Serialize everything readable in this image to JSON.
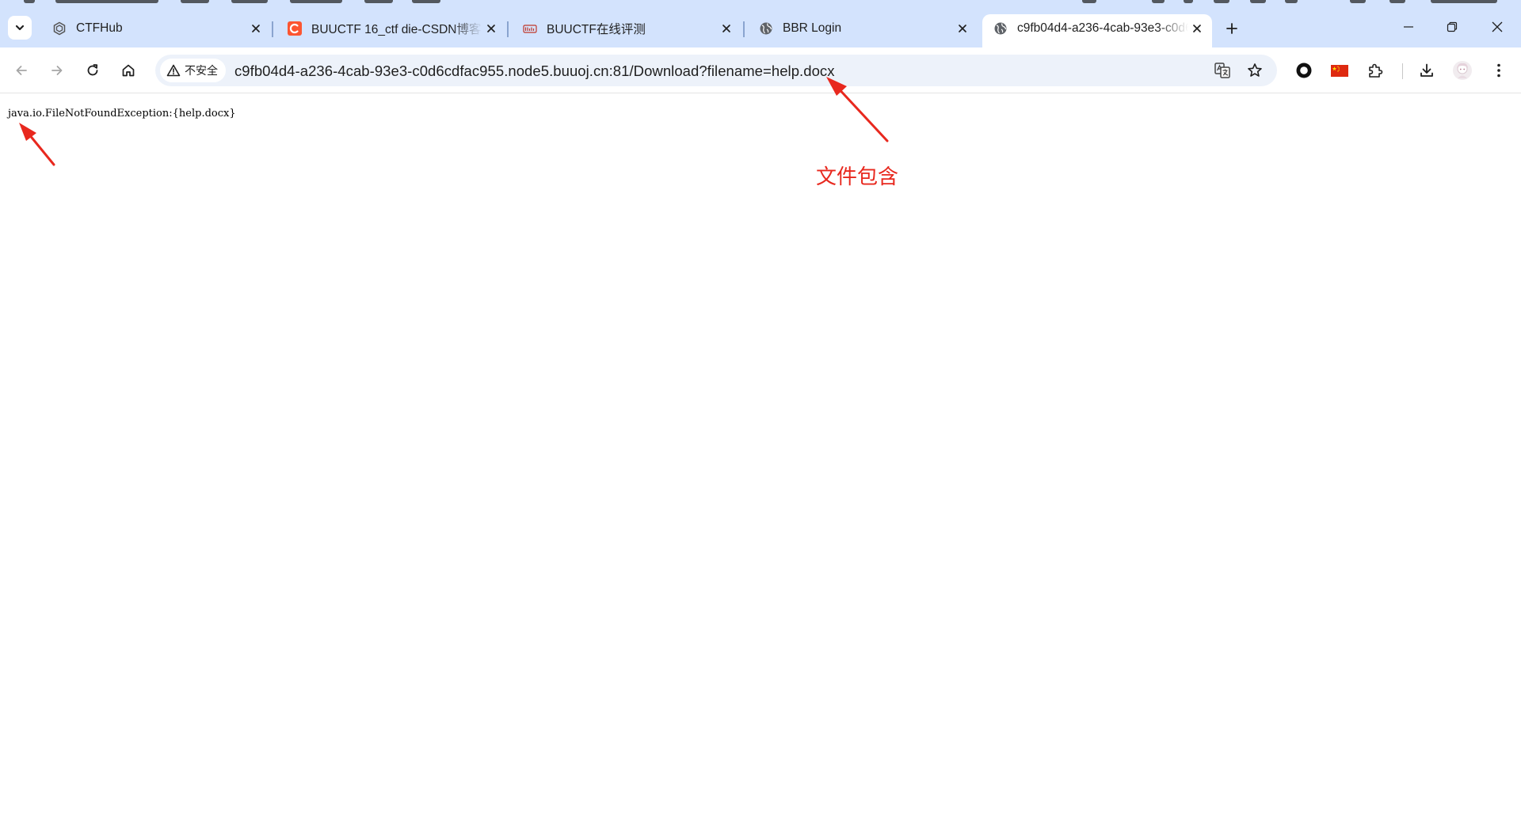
{
  "browser": {
    "tab_list_icon": "chevron-down-icon",
    "tabs": [
      {
        "title": "CTFHub",
        "favicon": "ctfhub-icon",
        "active": false
      },
      {
        "title": "BUUCTF 16_ctf die-CSDN博客",
        "favicon": "csdn-icon",
        "active": false
      },
      {
        "title": "BUUCTF在线评测",
        "favicon": "buuctf-icon",
        "active": false
      },
      {
        "title": "BBR Login",
        "favicon": "globe-icon",
        "active": false
      },
      {
        "title": "c9fb04d4-a236-4cab-93e3-c0d6cdfac955.node5.buuoj.cn:81/Download?filename=help.docx",
        "favicon": "globe-icon",
        "active": true
      }
    ],
    "new_tab_icon": "plus-icon",
    "window_controls": [
      "minimize-icon",
      "restore-icon",
      "close-icon"
    ]
  },
  "toolbar": {
    "nav_icons": [
      "back-arrow-icon",
      "forward-arrow-icon",
      "reload-icon",
      "home-icon"
    ],
    "security_chip": {
      "icon": "warning-triangle-icon",
      "label": "不安全"
    },
    "url": "c9fb04d4-a236-4cab-93e3-c0d6cdfac955.node5.buuoj.cn:81/Download?filename=help.docx",
    "omnibox_icons": [
      "translate-icon",
      "bookmark-star-icon"
    ],
    "extension_icons": [
      "circle-extension-icon",
      "china-flag-icon",
      "puzzle-extensions-icon",
      "download-icon",
      "profile-avatar-icon",
      "kebab-menu-icon"
    ]
  },
  "page": {
    "error_text": "java.io.FileNotFoundException:{help.docx}"
  },
  "annotation": {
    "label": "文件包含",
    "color": "#e8281e"
  },
  "colors": {
    "tabstrip_bg": "#d3e3fd",
    "omnibox_bg": "#edf2fa",
    "text": "#1f1f1f"
  }
}
